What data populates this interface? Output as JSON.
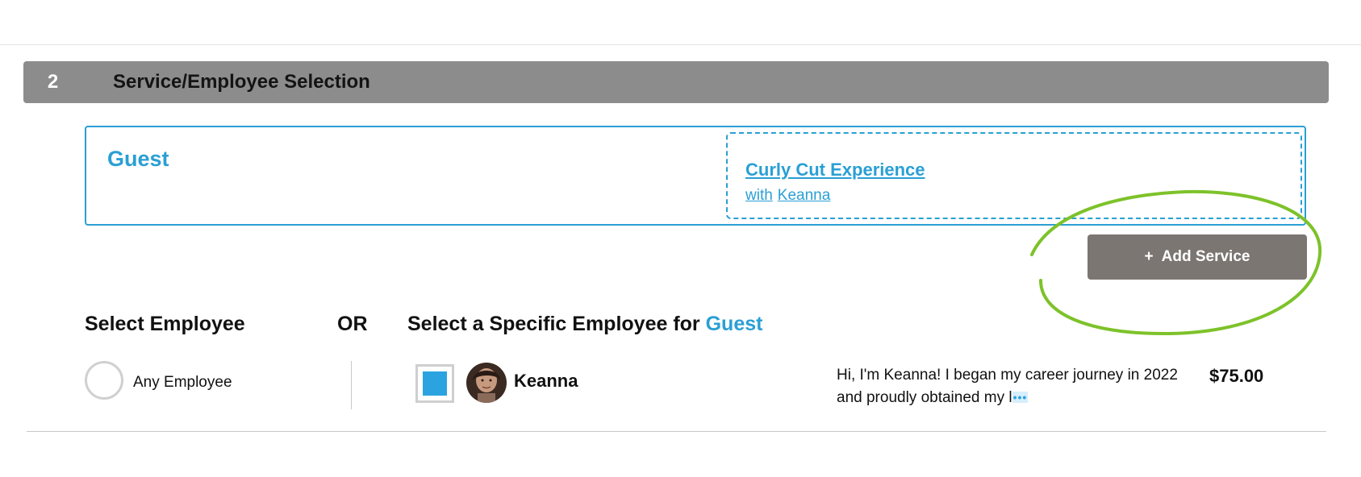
{
  "section": {
    "number": "2",
    "title": "Service/Employee Selection"
  },
  "guest_card": {
    "guest_name": "Guest",
    "service": {
      "name": "Curly Cut Experience",
      "with_label": "with",
      "employee": "Keanna"
    }
  },
  "add_service": {
    "icon": "+",
    "label": "Add Service"
  },
  "selection": {
    "select_employee_label": "Select Employee",
    "or_label": "OR",
    "specific_label": "Select a Specific Employee for",
    "specific_guest": "Guest",
    "any_employee_label": "Any Employee",
    "any_employee_selected": false
  },
  "employee": {
    "name": "Keanna",
    "selected": true,
    "bio": "Hi, I'm Keanna! I began my career journey in 2022 and proudly obtained my l",
    "bio_more": "•••",
    "price": "$75.00"
  },
  "colors": {
    "accent": "#2a9fd4",
    "header_bg": "#8c8c8c",
    "button_bg": "#7b7672",
    "annotation": "#7dc22a"
  }
}
